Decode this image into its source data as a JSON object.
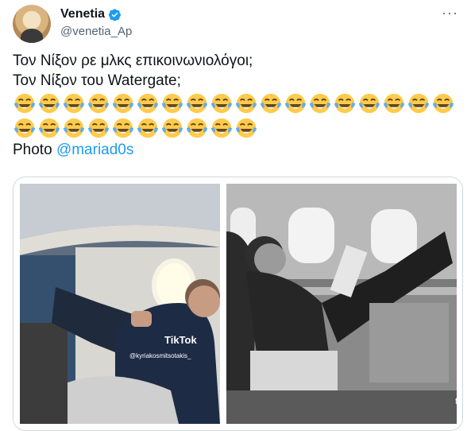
{
  "header": {
    "display_name": "Venetia",
    "handle": "@venetia_Ap",
    "more_label": "···"
  },
  "tweet": {
    "line1": "Τον Νίξον ρε μλκς επικοινωνιολόγοι;",
    "line2": "Τον Νίξον του Watergate;",
    "emoji_row1_count": 18,
    "emoji_row2_count": 10,
    "photo_prefix": "Photo",
    "photo_mention": "@mariad0s"
  },
  "media": {
    "left_photo": {
      "tiktok_label": "TikTok",
      "tiktok_user": "@kyriakosmitsotakis_"
    },
    "right_photo": {
      "watermark": "fi"
    }
  },
  "colors": {
    "accent": "#1d9bf0",
    "secondary_text": "#536471",
    "border": "#cfd9de"
  }
}
